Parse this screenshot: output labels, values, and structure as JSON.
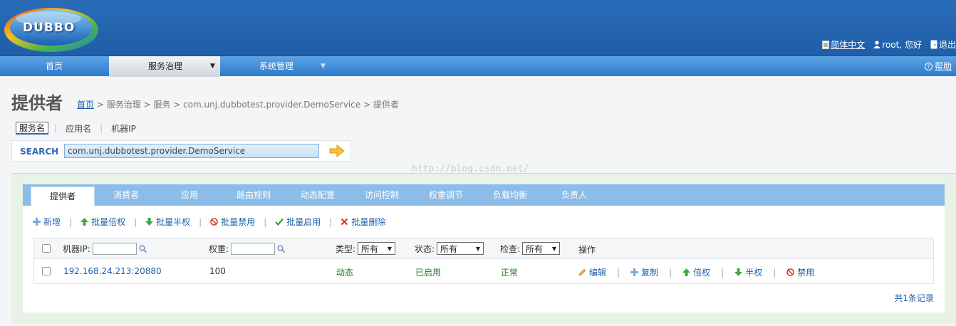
{
  "header": {
    "logo_text": "DUBBO",
    "links": [
      {
        "icon": "document-icon",
        "label": "简体中文"
      },
      {
        "icon": "user-icon",
        "label": "root, 您好"
      },
      {
        "icon": "exit-icon",
        "label": "退出"
      }
    ]
  },
  "nav": {
    "items": [
      {
        "label": "首页"
      },
      {
        "label": "服务治理",
        "active": true
      },
      {
        "label": "系统管理"
      }
    ],
    "help_label": "帮助"
  },
  "page": {
    "title": "提供者",
    "breadcrumb": {
      "home": "首页",
      "rest": " > 服务治理 > 服务 > com.unj.dubbotest.provider.DemoService > 提供者"
    }
  },
  "search": {
    "tabs": [
      "服务名",
      "应用名",
      "机器IP"
    ],
    "label": "SEARCH",
    "value": "com.unj.dubbotest.provider.DemoService"
  },
  "watermark": "http://blog.csdn.net/",
  "tabs": [
    "提供者",
    "消费者",
    "应用",
    "路由规则",
    "动态配置",
    "访问控制",
    "权重调节",
    "负载均衡",
    "负责人"
  ],
  "actions": {
    "add": "新增",
    "batch_double": "批量倍权",
    "batch_half": "批量半权",
    "batch_disable": "批量禁用",
    "batch_enable": "批量启用",
    "batch_delete": "批量删除"
  },
  "table": {
    "headers": {
      "ip": "机器IP:",
      "weight": "权重:",
      "type": "类型:",
      "status": "状态:",
      "check": "检查:",
      "ops": "操作"
    },
    "filters": {
      "type": "所有",
      "status": "所有",
      "check": "所有"
    },
    "rows": [
      {
        "ip": "192.168.24.213:20880",
        "weight": "100",
        "type": "动态",
        "status": "已启用",
        "check": "正常",
        "ops": {
          "edit": "编辑",
          "copy": "复制",
          "double": "倍权",
          "half": "半权",
          "disable": "禁用"
        }
      }
    ],
    "total": "共1条记录"
  },
  "colors": {
    "header_bg": "#1f5ea8",
    "nav_bg": "#3d8ad6",
    "tab_bar": "#8cbde8",
    "link": "#1f5fa8",
    "green": "#1f7a1f"
  }
}
